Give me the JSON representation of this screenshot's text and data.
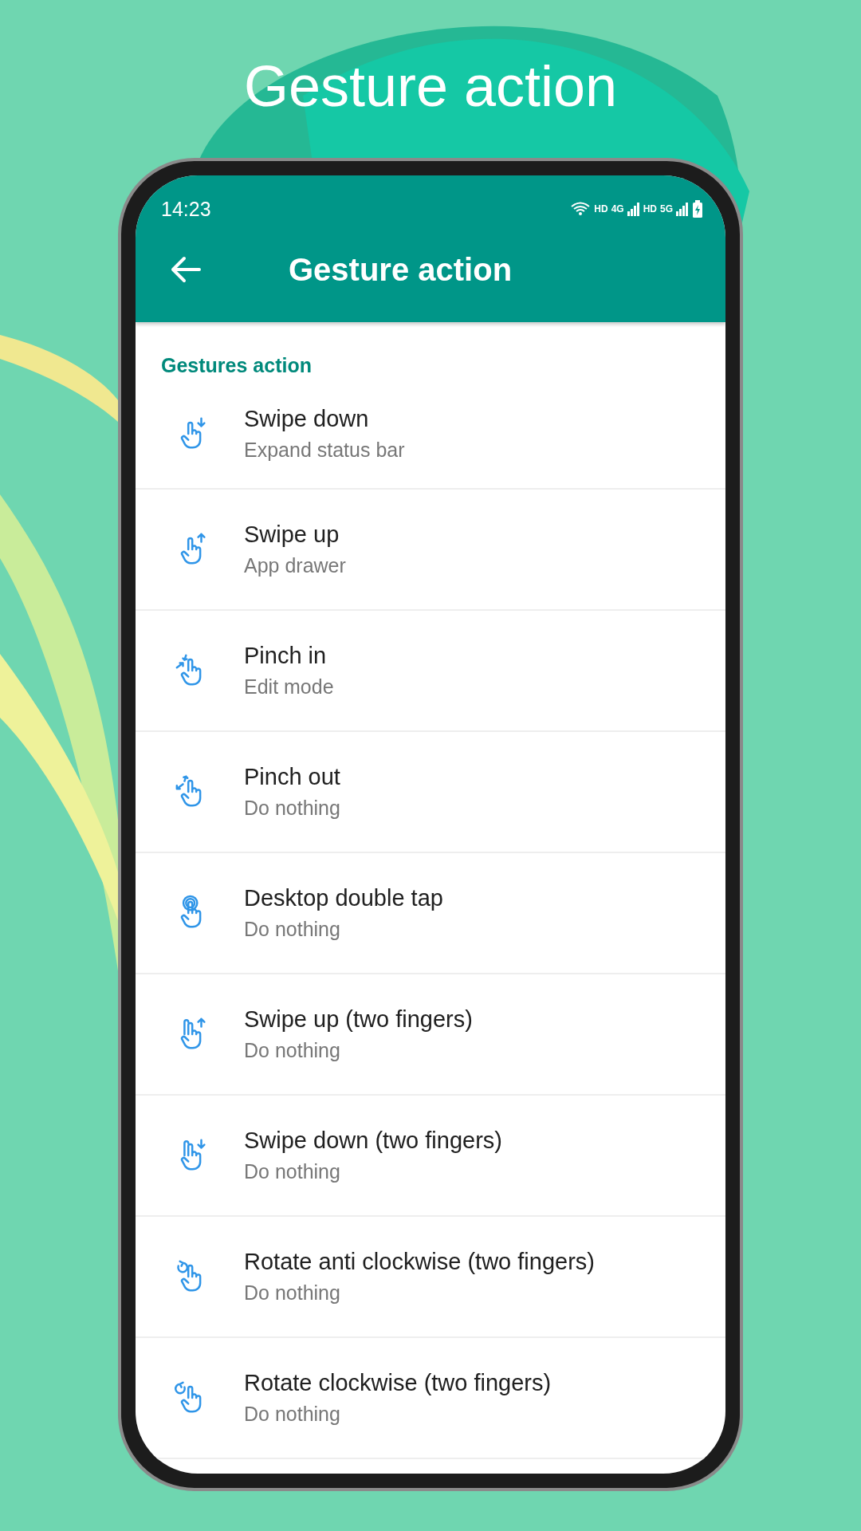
{
  "headline": "Gesture action",
  "status_bar": {
    "time": "14:23",
    "indicators": [
      "HD",
      "4G",
      "HD",
      "5G"
    ]
  },
  "app_bar": {
    "title": "Gesture action"
  },
  "section": {
    "title": "Gestures action"
  },
  "items": [
    {
      "kind": "swipe-down",
      "title": "Swipe down",
      "summary": "Expand status bar"
    },
    {
      "kind": "swipe-up",
      "title": "Swipe up",
      "summary": "App drawer"
    },
    {
      "kind": "pinch-in",
      "title": "Pinch in",
      "summary": "Edit mode"
    },
    {
      "kind": "pinch-out",
      "title": "Pinch out",
      "summary": "Do nothing"
    },
    {
      "kind": "double-tap",
      "title": "Desktop double tap",
      "summary": "Do nothing"
    },
    {
      "kind": "two-swipe-up",
      "title": "Swipe up (two fingers)",
      "summary": "Do nothing"
    },
    {
      "kind": "two-swipe-down",
      "title": "Swipe down (two fingers)",
      "summary": "Do nothing"
    },
    {
      "kind": "rotate-ccw",
      "title": "Rotate anti clockwise (two fingers)",
      "summary": "Do nothing"
    },
    {
      "kind": "rotate-cw",
      "title": "Rotate clockwise (two fingers)",
      "summary": "Do nothing"
    }
  ]
}
